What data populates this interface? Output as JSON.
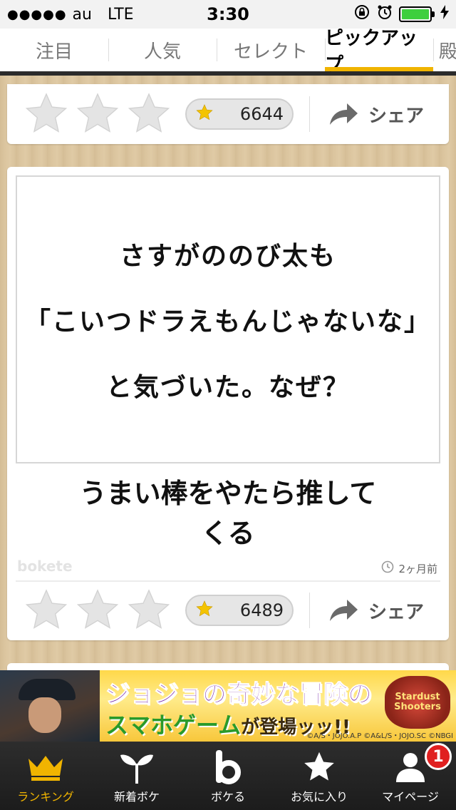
{
  "status_bar": {
    "signal": "●●●●●",
    "carrier": "au",
    "network": "LTE",
    "time": "3:30"
  },
  "tabs": [
    {
      "label": "注目",
      "active": false
    },
    {
      "label": "人気",
      "active": false
    },
    {
      "label": "セレクト",
      "active": false
    },
    {
      "label": "ピックアップ",
      "active": true
    },
    {
      "label": "殿",
      "active": false
    }
  ],
  "card_top": {
    "vote_count": "6644",
    "share_label": "シェア"
  },
  "card_main": {
    "image_lines": [
      "さすがののび太も",
      "「こいつドラえもんじゃないな」",
      "と気づいた。なぜ？"
    ],
    "answer_lines": [
      "うまい棒をやたら推して",
      "くる"
    ],
    "logo": "bokete",
    "time_ago": "2ヶ月前",
    "vote_count": "6489",
    "share_label": "シェア"
  },
  "banner": {
    "title_line1": "ジョジョの奇妙な冒険の",
    "title_line2": "スマホゲーム",
    "title_line2_suffix": "が登場ッッ!!",
    "copyright": "©A/S・JOJO.A.P ©A&L/S・JOJO.SC ©NBGI",
    "badge_text": "Stardust Shooters"
  },
  "bottom_nav": [
    {
      "label": "ランキング",
      "icon": "crown-icon",
      "active": true
    },
    {
      "label": "新着ボケ",
      "icon": "sprout-icon",
      "active": false
    },
    {
      "label": "ボケる",
      "icon": "bokete-b-icon",
      "active": false
    },
    {
      "label": "お気に入り",
      "icon": "star-icon",
      "active": false
    },
    {
      "label": "マイページ",
      "icon": "user-icon",
      "active": false,
      "badge": "1"
    }
  ],
  "colors": {
    "accent": "#f0b400",
    "tab_underline": "#2b2b2b",
    "notification": "#e02020"
  }
}
